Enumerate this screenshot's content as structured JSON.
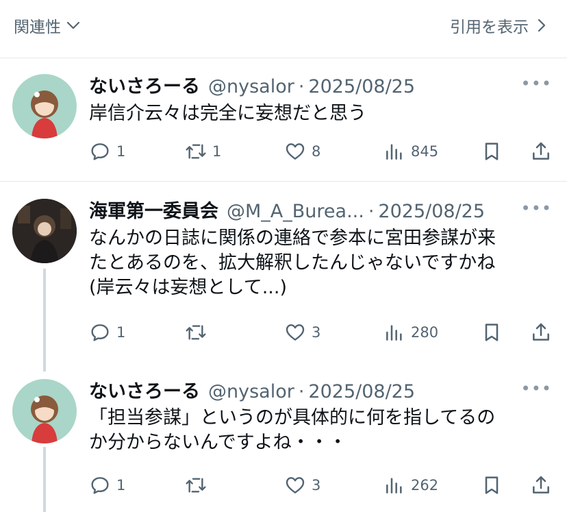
{
  "header": {
    "sort_label": "関連性",
    "quotes_label": "引用を表示"
  },
  "tweets": [
    {
      "name": "ないさろーる",
      "handle": "@nysalor",
      "separator": "·",
      "date": "2025/08/25",
      "text": "岸信介云々は完全に妄想だと思う",
      "replies": "1",
      "retweets": "1",
      "likes": "8",
      "views": "845"
    },
    {
      "name": "海軍第一委員会",
      "handle": "@M_A_Burea...",
      "separator": "·",
      "date": "2025/08/25",
      "text": "なんかの日誌に関係の連絡で参本に宮田参謀が来\nたとあるのを、拡大解釈したんじゃないですかね\n(岸云々は妄想として...)",
      "replies": "1",
      "retweets": "",
      "likes": "3",
      "views": "280"
    },
    {
      "name": "ないさろーる",
      "handle": "@nysalor",
      "separator": "·",
      "date": "2025/08/25",
      "text": "「担当参謀」というのが具体的に何を指してるの\nか分からないんですよね・・・",
      "replies": "1",
      "retweets": "",
      "likes": "3",
      "views": "262"
    }
  ]
}
